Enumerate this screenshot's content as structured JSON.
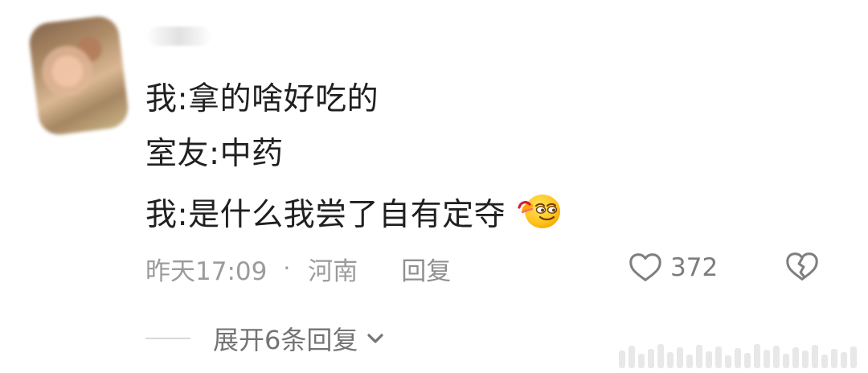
{
  "comment": {
    "lines": [
      "我:拿的啥好吃的",
      "室友:中药",
      "我:是什么我尝了自有定夺"
    ],
    "emoji": "smirking-drool-emoji",
    "meta": {
      "time": "昨天17:09",
      "dot": "·",
      "location": "河南",
      "reply": "回复"
    },
    "likes": "372",
    "expand_replies": "展开6条回复"
  },
  "icons": {
    "like": "heart-icon",
    "dislike": "broken-heart-icon",
    "expand": "chevron-down-icon"
  },
  "colors": {
    "text_primary": "#202020",
    "text_secondary": "#9b9b9b",
    "icon_gray": "#7f7f7f"
  }
}
